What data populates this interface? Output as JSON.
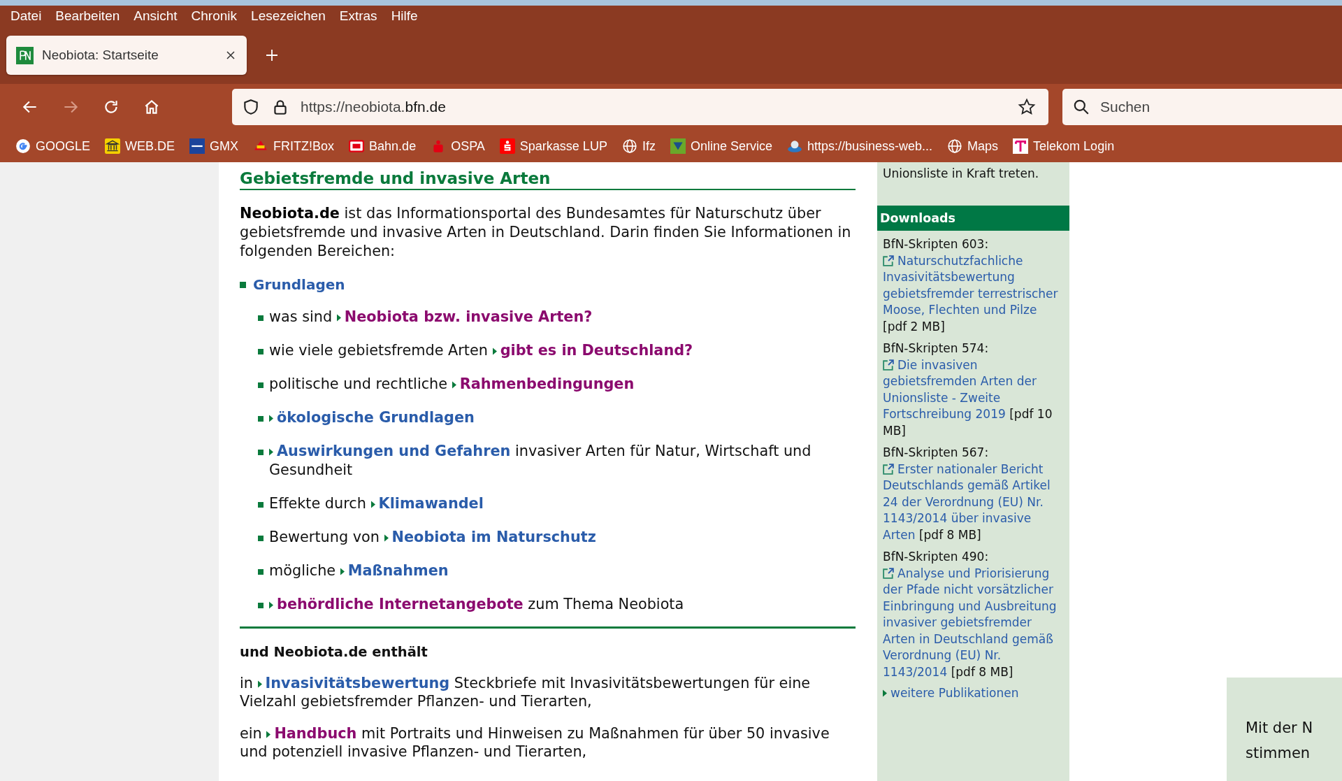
{
  "menu_bar": [
    "Datei",
    "Bearbeiten",
    "Ansicht",
    "Chronik",
    "Lesezeichen",
    "Extras",
    "Hilfe"
  ],
  "tabs": [
    {
      "title": "Neobiota: Startseite",
      "selected": true
    }
  ],
  "nav_buttons": [
    {
      "kind": "back",
      "disabled": false
    },
    {
      "kind": "forward",
      "disabled": true
    },
    {
      "kind": "reload",
      "disabled": false
    },
    {
      "kind": "home",
      "disabled": false
    }
  ],
  "address_bar": {
    "url_prefix": "https://neobiota.",
    "url_domain": "bfn.de"
  },
  "search": {
    "placeholder": "Suchen"
  },
  "bookmarks": [
    {
      "kind": "google",
      "label": "GOOGLE"
    },
    {
      "kind": "webde",
      "label": "WEB.DE"
    },
    {
      "kind": "gmx",
      "label": "GMX"
    },
    {
      "kind": "fritz",
      "label": "FRITZ!Box"
    },
    {
      "kind": "db",
      "label": "Bahn.de"
    },
    {
      "kind": "ospa",
      "label": "OSPA"
    },
    {
      "kind": "sparkasse",
      "label": "Sparkasse LUP"
    },
    {
      "kind": "globe",
      "label": "Ifz"
    },
    {
      "kind": "service",
      "label": "Online Service"
    },
    {
      "kind": "business",
      "label": "https://business-web..."
    },
    {
      "kind": "globe",
      "label": "Maps"
    },
    {
      "kind": "telekom",
      "label": "Telekom Login"
    }
  ],
  "main": {
    "heading": "Gebietsfremde und invasive Arten",
    "intro": "**Neobiota.de** ist das Informationsportal des Bundesamtes für Naturschutz über gebietsfremde und invasive Arten in Deutschland. Darin finden Sie Informationen in folgenden Bereichen:",
    "section": {
      "title": "Grundlagen",
      "children": [
        {
          "before": "was sind",
          "link": "Neobiota bzw. invasive Arten?",
          "visited": true
        },
        {
          "before": "wie viele gebietsfremde Arten",
          "link": "gibt es in Deutschland?",
          "visited": true
        },
        {
          "before": "politische und rechtliche",
          "link": "Rahmenbedingungen",
          "visited": true
        },
        {
          "link": "ökologische Grundlagen",
          "visited": false
        },
        {
          "link": "Auswirkungen und Gefahren",
          "after": "invasiver Arten für Natur, Wirtschaft und Gesundheit",
          "visited": false
        },
        {
          "before": "Effekte durch",
          "link": "Klimawandel",
          "visited": false
        },
        {
          "before": "Bewertung von",
          "link": "Neobiota im Naturschutz",
          "visited": false
        },
        {
          "before": "mögliche",
          "link": "Maßnahmen",
          "visited": false
        },
        {
          "link": "behördliche Internetangebote",
          "after": "zum Thema Neobiota",
          "visited": true
        }
      ]
    },
    "subheading": "und Neobiota.de enthält",
    "paragraphs": [
      {
        "before": "in",
        "link": "Invasivitätsbewertung",
        "after": "Steckbriefe mit Invasivitätsbewertungen für eine Vielzahl gebietsfremder Pflanzen- und Tierarten,",
        "visited": false
      },
      {
        "before": "ein",
        "link": "Handbuch",
        "after": "mit Portraits und Hinweisen zu Maßnahmen für über 50 invasive und potenziell invasive Pflanzen- und Tierarten,",
        "visited": true
      }
    ]
  },
  "sidebar": {
    "top_text": "Unionsliste in Kraft treten.",
    "downloads_title": "Downloads",
    "downloads": [
      {
        "series": "BfN-Skripten 603:",
        "link": "Naturschutzfachliche Invasivitätsbewertung gebietsfremder terrestrischer Moose, Flechten und Pilze",
        "size": "[pdf 2 MB]"
      },
      {
        "series": "BfN-Skripten 574:",
        "link": "Die invasiven gebietsfremden Arten der Unionsliste - Zweite Fortschreibung 2019",
        "size": "[pdf 10 MB]"
      },
      {
        "series": "BfN-Skripten 567:",
        "link": "Erster nationaler Bericht Deutschlands gemäß Artikel 24 der Verordnung (EU) Nr. 1143/2014 über invasive Arten",
        "size": "[pdf 8 MB]"
      },
      {
        "series": "BfN-Skripten 490:",
        "link": "Analyse und Priorisierung der Pfade nicht vorsätzlicher Einbringung und Ausbreitung invasiver gebietsfremder Arten in Deutschland gemäß Verordnung (EU) Nr. 1143/2014",
        "size": "[pdf 8 MB]"
      }
    ],
    "more_link": "weitere Publikationen"
  },
  "cookie_notice": {
    "lines": [
      "Mit der N",
      "stimmen"
    ]
  }
}
